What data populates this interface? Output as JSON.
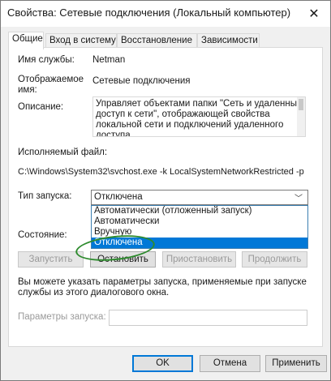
{
  "window": {
    "title": "Свойства: Сетевые подключения (Локальный компьютер)",
    "close_symbol": "✕"
  },
  "tabs": [
    {
      "label": "Общие",
      "active": true
    },
    {
      "label": "Вход в систему",
      "active": false
    },
    {
      "label": "Восстановление",
      "active": false
    },
    {
      "label": "Зависимости",
      "active": false
    }
  ],
  "general": {
    "service_name_label": "Имя службы:",
    "service_name_value": "Netman",
    "display_name_label_1": "Отображаемое",
    "display_name_label_2": "имя:",
    "display_name_value": "Сетевые подключения",
    "description_label": "Описание:",
    "description_lines": [
      "Управляет объектами папки \"Сеть и удаленный",
      "доступ к сети\", отображающей свойства",
      "локальной сети и подключений удаленного",
      "доступа."
    ],
    "executable_label": "Исполняемый файл:",
    "executable_path": "C:\\Windows\\System32\\svchost.exe -k LocalSystemNetworkRestricted -p",
    "startup_type_label": "Тип запуска:",
    "startup_type_value": "Отключена",
    "startup_options": [
      "Автоматически (отложенный запуск)",
      "Автоматически",
      "Вручную",
      "Отключена"
    ],
    "selected_option_index": 3,
    "status_label": "Состояние:",
    "buttons": {
      "start": "Запустить",
      "stop": "Остановить",
      "pause": "Приостановить",
      "resume": "Продолжить"
    },
    "hint_line_1": "Вы можете указать параметры запуска, применяемые при запуске",
    "hint_line_2": "службы из этого диалогового окна.",
    "start_params_label": "Параметры запуска:"
  },
  "footer": {
    "ok": "OK",
    "cancel": "Отмена",
    "apply": "Применить"
  },
  "colors": {
    "accent": "#0078d7",
    "annotation": "#2e8b2e"
  },
  "icons": {
    "close": "close-icon",
    "dropdown": "chevron-down-icon"
  }
}
